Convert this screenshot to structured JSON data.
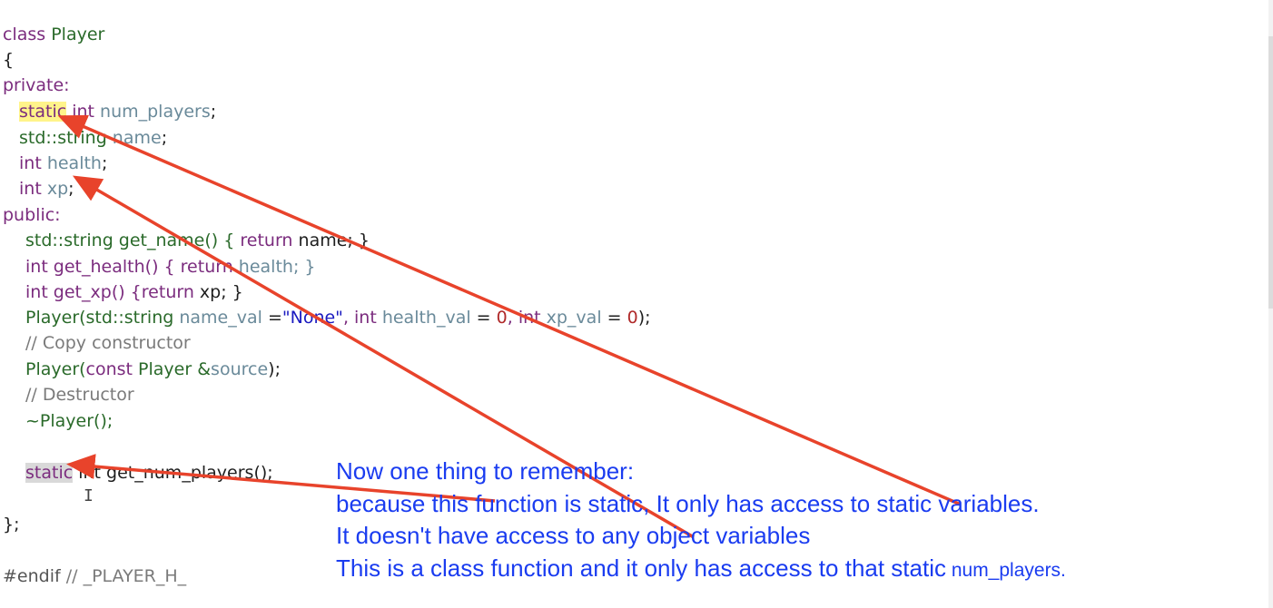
{
  "code": {
    "l1_kw": "class",
    "l1_name": " Player",
    "l2": "{",
    "l3": "private:",
    "l4_static": "static",
    "l4_type": " int",
    "l4_var": " num_players",
    "l4_end": ";",
    "l5_type": "std::string",
    "l5_var": " name",
    "l5_end": ";",
    "l6_type": "int",
    "l6_var": " health",
    "l6_end": ";",
    "l7_type": "int",
    "l7_var": " xp",
    "l7_end": ";",
    "l8": "public:",
    "l9_a": "std::string get_name() { ",
    "l9_kw": "return",
    "l9_b": " name; }",
    "l10_a": "int get_health() { ",
    "l10_kw": "return",
    "l10_b": " health; }",
    "l11_a": "int get_xp() {",
    "l11_kw": "return",
    "l11_b": " xp; }",
    "l12_a": "Player(std::string ",
    "l12_v1": "name_val",
    "l12_b": " =",
    "l12_s": "\"None\"",
    "l12_c": ", int ",
    "l12_v2": "health_val",
    "l12_d": " = ",
    "l12_n1": "0",
    "l12_e": ", int ",
    "l12_v3": "xp_val",
    "l12_f": " = ",
    "l12_n2": "0",
    "l12_g": ");",
    "l13": "// Copy constructor",
    "l14_a": "Player(",
    "l14_kw": "const",
    "l14_b": " Player &",
    "l14_v": "source",
    "l14_c": ");",
    "l15": "// Destructor",
    "l16": "~Player();",
    "l18_static": "static",
    "l18_rest": " int get_num_players();",
    "l19_cursor": "I",
    "l20": "};",
    "l22_pp": "#endif",
    "l22_cmt": " // _PLAYER_H_"
  },
  "annotation": {
    "line1": "Now one thing to remember:",
    "line2": "because this function is static, It only has access to static variables.",
    "line3": "It doesn't have access to any object variables",
    "line4_main": "This is a class function and it only has access to that static",
    "line4_small": " num_players."
  },
  "colors": {
    "arrow": "#e8432b",
    "annotation_text": "#1a3cf0",
    "highlight_static": "#fff48a"
  }
}
